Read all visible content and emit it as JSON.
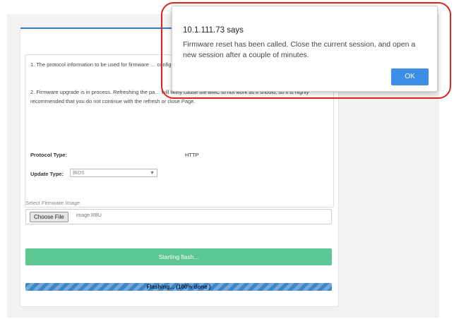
{
  "card": {
    "note1": "1. The protocol information to be used for firmware … configure, choose \"Firmware Image Location\" under …",
    "note2": "2. Firmware upgrade is in process. Refreshing the pa… will likely cause the BMC to not work as it should, so it is highly recommended that you do not continue with the refresh or close Page.",
    "protocol_label": "Protocol Type:",
    "protocol_value": "HTTP",
    "update_label": "Update Type:",
    "update_value": "BIOS",
    "file_label": "Select Firmware Image",
    "choose_file": "Choose File",
    "file_hint": "image.RBU",
    "flash_button": "Starting flash...",
    "progress_text": "Flashing... (100% done )",
    "progress_percent": 100
  },
  "dialog": {
    "title": "10.1.111.73 says",
    "message": "Firmware reset has been called. Close the current session, and open a new session after a couple of minutes.",
    "ok": "OK"
  },
  "colors": {
    "accent": "#3a7dc6",
    "flash_green": "#5cc792",
    "ok_blue": "#3d8ee6",
    "highlight_red": "#e0201a"
  }
}
